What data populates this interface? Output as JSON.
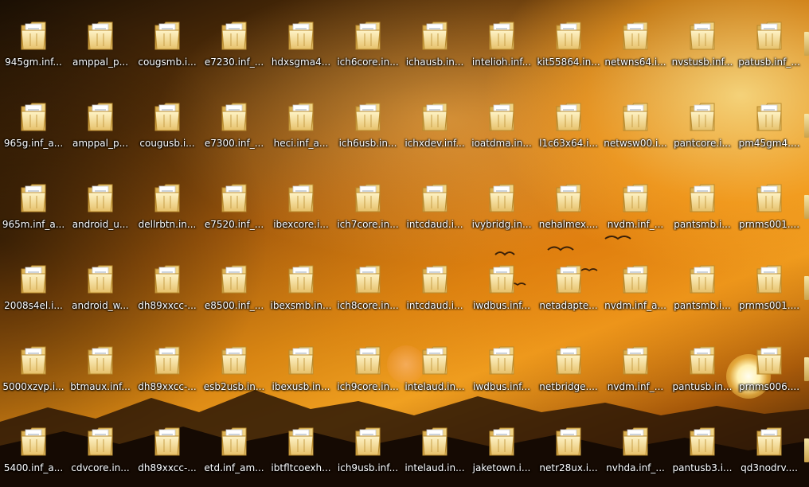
{
  "desktop": {
    "columns": [
      [
        "945gm.inf...",
        "965g.inf_a...",
        "965m.inf_a...",
        "2008s4el.i...",
        "5000xzvp.i...",
        "5400.inf_a..."
      ],
      [
        "amppal_p...",
        "amppal_p...",
        "android_u...",
        "android_w...",
        "btmaux.inf...",
        "cdvcore.in..."
      ],
      [
        "cougsmb.i...",
        "cougusb.i...",
        "dellrbtn.in...",
        "dh89xxcc-...",
        "dh89xxcc-...",
        "dh89xxcc-..."
      ],
      [
        "e7230.inf_...",
        "e7300.inf_...",
        "e7520.inf_...",
        "e8500.inf_...",
        "esb2usb.in...",
        "etd.inf_am..."
      ],
      [
        "hdxsgma4...",
        "heci.inf_a...",
        "ibexcore.i...",
        "ibexsmb.in...",
        "ibexusb.in...",
        "ibtfltcoexh..."
      ],
      [
        "ich6core.in...",
        "ich6usb.in...",
        "ich7core.in...",
        "ich8core.in...",
        "ich9core.in...",
        "ich9usb.inf..."
      ],
      [
        "ichausb.in...",
        "ichxdev.inf...",
        "intcdaud.i...",
        "intcdaud.i...",
        "intelaud.in...",
        "intelaud.in..."
      ],
      [
        "intelioh.inf...",
        "ioatdma.in...",
        "ivybridg.in...",
        "iwdbus.inf...",
        "iwdbus.inf...",
        "jaketown.i..."
      ],
      [
        "kit55864.in...",
        "l1c63x64.i...",
        "nehalmex....",
        "netadapte...",
        "netbridge....",
        "netr28ux.i..."
      ],
      [
        "netwns64.i...",
        "netwsw00.i...",
        "nvdm.inf_...",
        "nvdm.inf_a...",
        "nvdm.inf_...",
        "nvhda.inf_..."
      ],
      [
        "nvstusb.inf...",
        "pantcore.i...",
        "pantsmb.i...",
        "pantsmb.i...",
        "pantusb.in...",
        "pantusb3.i..."
      ],
      [
        "patusb.inf_...",
        "pm45gm4....",
        "prnms001....",
        "prnms001....",
        "prnms006....",
        "qd3nodrv...."
      ]
    ]
  }
}
